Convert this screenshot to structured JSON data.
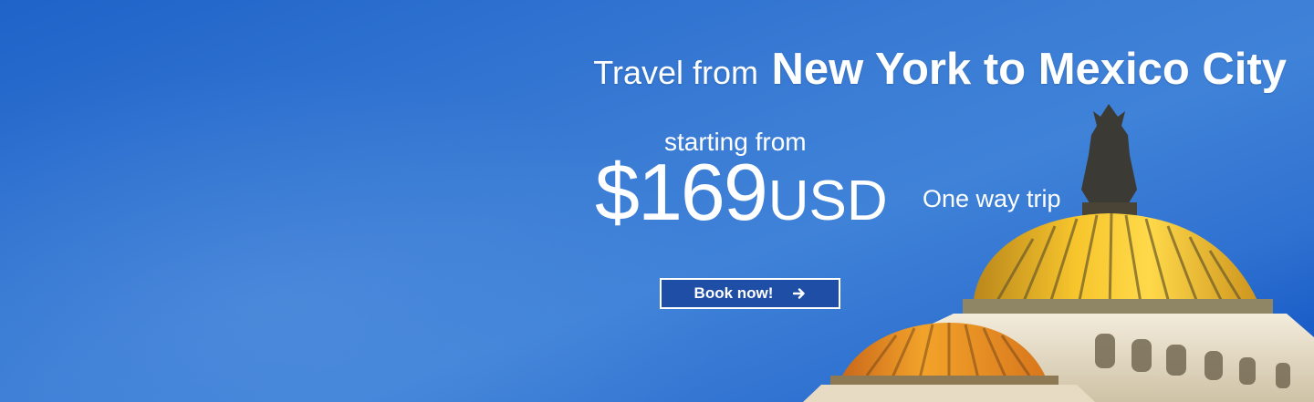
{
  "hero": {
    "headline_prefix": "Travel from",
    "headline_route": "New York to Mexico City",
    "starting_text": "starting from",
    "price": "$169",
    "currency": "USD",
    "trip_type": "One way trip",
    "cta_label": "Book now!",
    "cta_icon": "arrow-right-icon"
  },
  "colors": {
    "sky_top": "#1f63c9",
    "sky_mid": "#3f82d8",
    "cta_background": "#1e4ea6",
    "dome_gold": "#f3b623",
    "dome_orange": "#e98a1b",
    "marble": "#e8dfcb"
  }
}
